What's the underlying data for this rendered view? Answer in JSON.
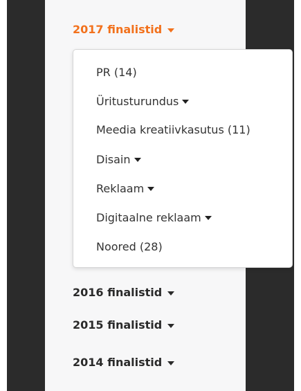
{
  "menu": {
    "active_year": "2017 finalistid",
    "categories": [
      {
        "label": "PR (14)",
        "has_submenu": false
      },
      {
        "label": "Üritusturundus",
        "has_submenu": true
      },
      {
        "label": "Meedia kreatiivkasutus (11)",
        "has_submenu": false
      },
      {
        "label": "Disain",
        "has_submenu": true
      },
      {
        "label": "Reklaam",
        "has_submenu": true
      },
      {
        "label": "Digitaalne reklaam",
        "has_submenu": true
      },
      {
        "label": "Noored (28)",
        "has_submenu": false
      }
    ],
    "other_years": [
      {
        "label": "2016 finalistid"
      },
      {
        "label": "2015 finalistid"
      },
      {
        "label": "2014 finalistid"
      }
    ]
  },
  "colors": {
    "accent": "#f2711c",
    "text": "#2a2a2a",
    "panel": "#f7f7f8",
    "dark_side": "#2b2b2b"
  },
  "icons": {
    "dropdown_caret": "caret-down-icon"
  }
}
